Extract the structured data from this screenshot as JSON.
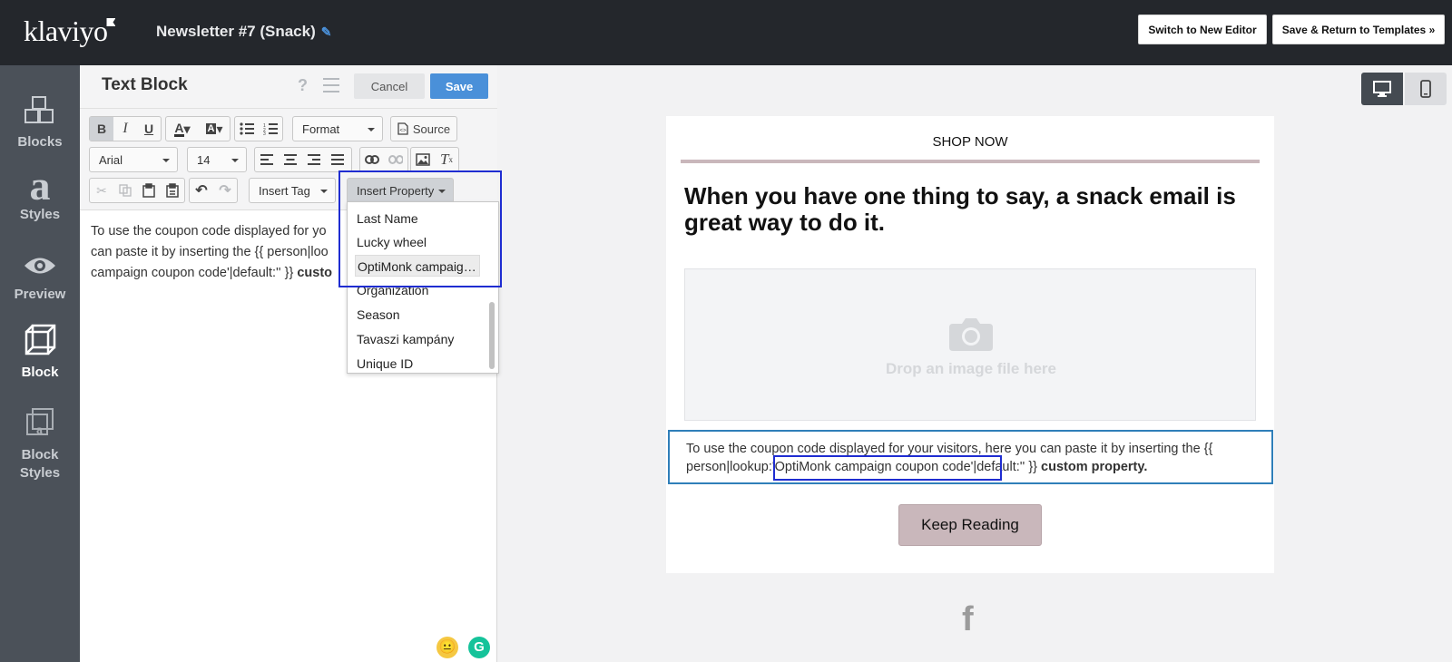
{
  "header": {
    "logo": "klaviyo",
    "doc_title": "Newsletter #7 (Snack)",
    "switch_label": "Switch to New Editor",
    "save_return_label": "Save & Return to Templates »"
  },
  "nav": {
    "items": [
      {
        "label": "Blocks",
        "icon": "blocks-icon"
      },
      {
        "label": "Styles",
        "icon": "styles-icon"
      },
      {
        "label": "Preview",
        "icon": "eye-icon"
      },
      {
        "label": "Block",
        "icon": "cube-icon"
      },
      {
        "label": "Block Styles",
        "icon": "block-styles-icon"
      }
    ],
    "active": "Block"
  },
  "editor": {
    "title": "Text Block",
    "help": "?",
    "cancel_label": "Cancel",
    "save_label": "Save",
    "format_label": "Format",
    "source_label": "Source",
    "font_value": "Arial",
    "size_value": "14",
    "insert_tag_label": "Insert Tag",
    "insert_property_label": "Insert Property",
    "body_text_1": "To use the coupon code displayed for yo",
    "body_text_2": "can paste it by inserting the {{ person|loo",
    "body_text_3": "campaign coupon code'|default:'' }} ",
    "body_text_3b": "custo"
  },
  "property_dropdown": {
    "items": [
      "Last Name",
      "Lucky wheel",
      "OptiMonk campaign coupon code",
      "Organization",
      "Season",
      "Tavaszi kampány",
      "Unique ID"
    ],
    "highlighted": "OptiMonk campaign coupon code"
  },
  "email": {
    "shop_now": "SHOP NOW",
    "headline": "When you have one thing to say, a snack email is great way to do it.",
    "drop_text": "Drop an image file here",
    "text_1": "To use the coupon code displayed for your visitors, here you can paste it by inserting the {{",
    "text_2a": "person|lookup:",
    "text_2b": "'OptiMonk campaign coupon code'",
    "text_2c": "|default:'' }} ",
    "text_2d": "custom property.",
    "button_label": "Keep Reading",
    "social_icon": "f"
  },
  "colors": {
    "topbar": "#24272c",
    "nav": "#4b5159",
    "accent_blue": "#4a90d9",
    "button_rose": "#c9b7bb",
    "highlight_box": "#1f2dd1"
  }
}
